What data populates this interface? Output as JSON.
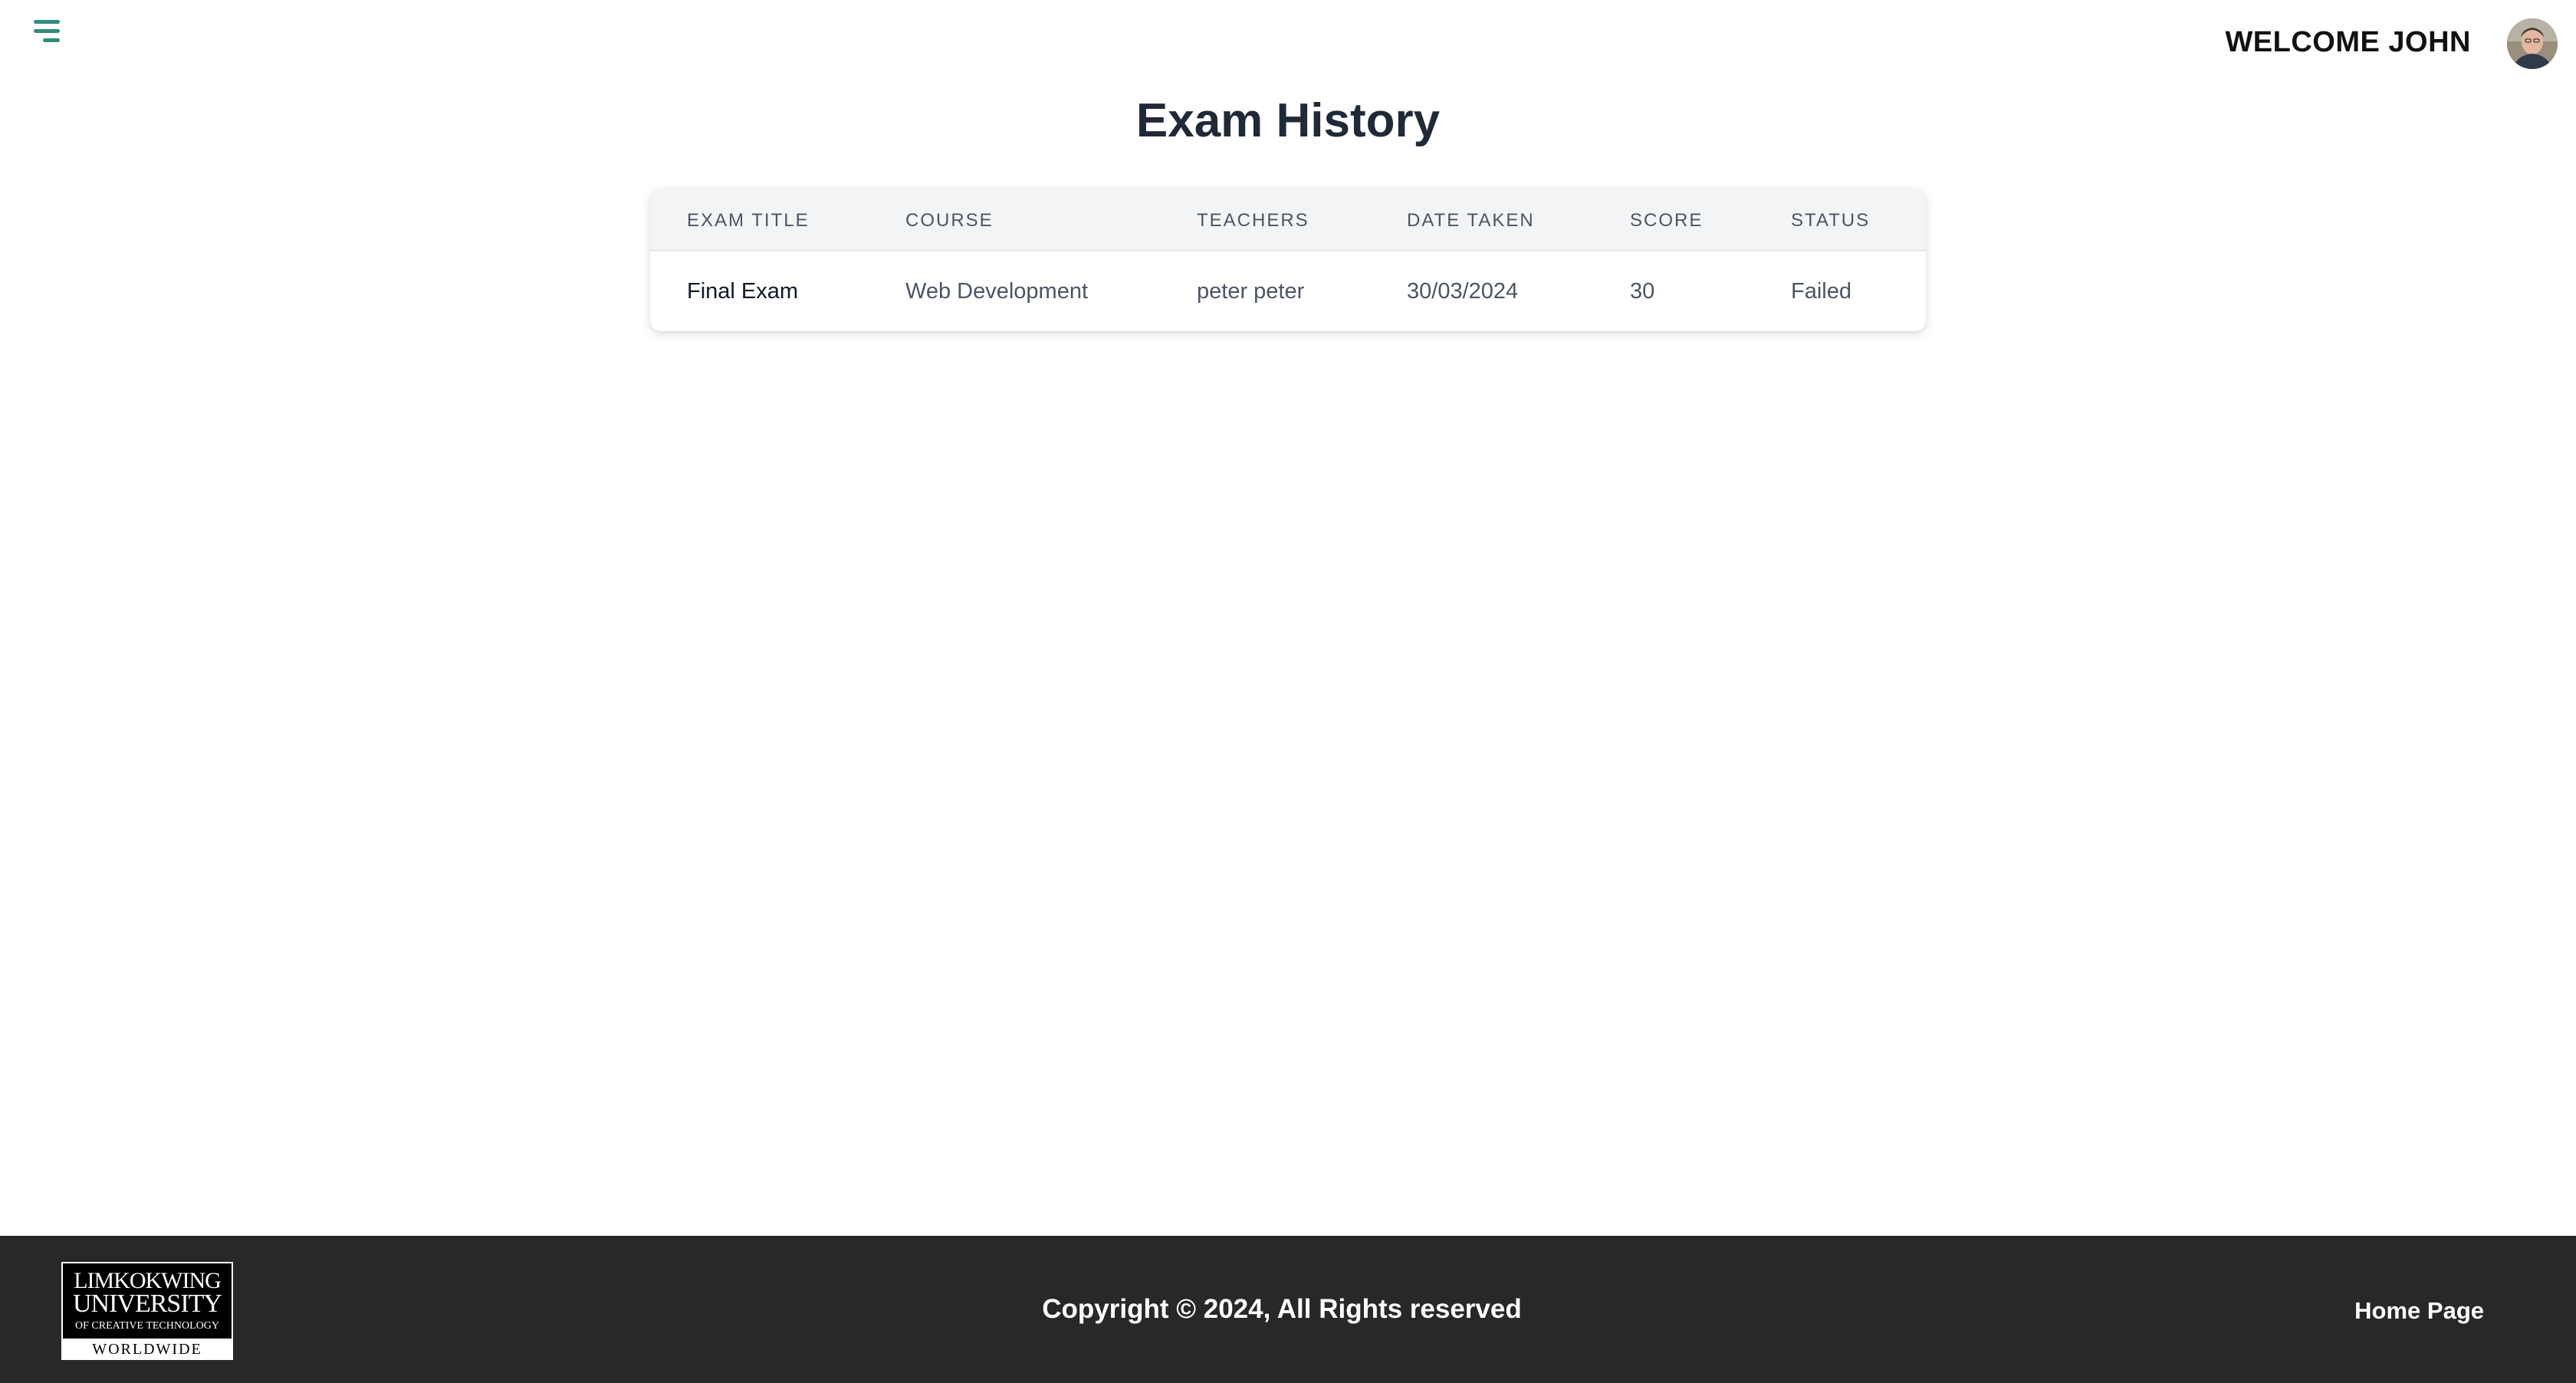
{
  "header": {
    "menu_icon": "hamburger-menu-icon",
    "welcome_text": "WELCOME JOHN",
    "avatar": "user-avatar"
  },
  "page": {
    "title": "Exam History"
  },
  "table": {
    "columns": [
      "EXAM TITLE",
      "COURSE",
      "TEACHERS",
      "DATE TAKEN",
      "SCORE",
      "STATUS"
    ],
    "rows": [
      {
        "exam_title": "Final Exam",
        "course": "Web Development",
        "teachers": "peter peter",
        "date_taken": "30/03/2024",
        "score": "30",
        "status": "Failed"
      }
    ]
  },
  "footer": {
    "logo": {
      "line1": "LIMKOKWING",
      "line2": "UNIVERSITY",
      "line3": "OF CREATIVE TECHNOLOGY",
      "line4": "WORLDWIDE"
    },
    "copyright": "Copyright © 2024, All Rights reserved",
    "home_link": "Home Page"
  },
  "colors": {
    "accent": "#2f8c80",
    "footer_bg": "#282828",
    "table_header_bg": "#f3f4f6"
  }
}
